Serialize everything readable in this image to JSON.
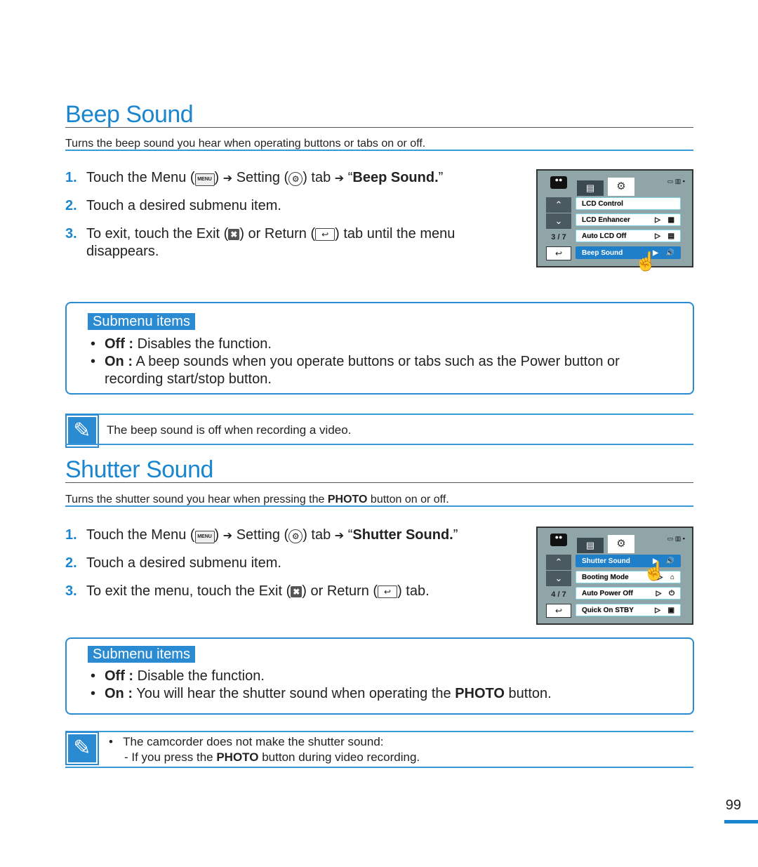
{
  "beep": {
    "title": "Beep Sound",
    "intro": "Turns the beep sound you hear when operating buttons or tabs on or off.",
    "steps": [
      {
        "num": "1.",
        "pre": "Touch the Menu (",
        "menu_icon": "MENU",
        "mid1": ") ",
        "arrow": "➔",
        "mid2": " Setting (",
        "gear_icon": "⚙",
        "mid3": ") tab ",
        "mid4": " “",
        "bold": "Beep Sound.",
        "post": "”"
      },
      {
        "num": "2.",
        "text": "Touch a desired submenu item."
      },
      {
        "num": "3.",
        "pre": "To exit, touch the Exit (",
        "exit_icon": "✖",
        "mid": ") or Return (",
        "return_icon": "↩",
        "post": ") tab until the menu",
        "line2": "disappears."
      }
    ],
    "submenu_label": "Submenu items",
    "submenu_items": [
      {
        "key": "Off :",
        "text": " Disables the function."
      },
      {
        "key": "On :",
        "text": " A beep sounds when you operate buttons or tabs such as the Power button or",
        "line2": "recording start/stop button."
      }
    ],
    "note": "The beep sound is off when recording a video.",
    "screen": {
      "page": "3 / 7",
      "items": [
        {
          "label": "LCD Control",
          "right": "",
          "selected": false
        },
        {
          "label": "LCD Enhancer",
          "right": "▷ ▦",
          "selected": false
        },
        {
          "label": "Auto LCD Off",
          "right": "▷ ▤",
          "selected": false
        },
        {
          "label": "Beep Sound",
          "right": "▶ 🔊",
          "selected": true
        }
      ]
    }
  },
  "shutter": {
    "title": "Shutter Sound",
    "intro_pre": "Turns the shutter sound you hear when pressing the ",
    "intro_bold": "PHOTO",
    "intro_post": " button on or off.",
    "steps": [
      {
        "num": "1.",
        "pre": "Touch the Menu (",
        "menu_icon": "MENU",
        "mid1": ") ",
        "arrow": "➔",
        "mid2": " Setting (",
        "gear_icon": "⚙",
        "mid3": ") tab ",
        "mid4": " “",
        "bold": "Shutter Sound.",
        "post": "”"
      },
      {
        "num": "2.",
        "text": "Touch a desired submenu item."
      },
      {
        "num": "3.",
        "pre": "To exit the menu, touch the Exit (",
        "exit_icon": "✖",
        "mid": ") or Return (",
        "return_icon": "↩",
        "post": ") tab."
      }
    ],
    "submenu_label": "Submenu items",
    "submenu_items": [
      {
        "key": "Off :",
        "text": " Disable the function."
      },
      {
        "key": "On :",
        "text_pre": " You will hear the shutter sound when operating the ",
        "bold": "PHOTO",
        "text_post": " button."
      }
    ],
    "note_line1": "The camcorder does not make the shutter sound:",
    "note_line2_pre": "-   If you press the ",
    "note_line2_bold": "PHOTO",
    "note_line2_post": " button during video recording.",
    "screen": {
      "page": "4 / 7",
      "items": [
        {
          "label": "Shutter Sound",
          "right": "▶ 🔊",
          "selected": true
        },
        {
          "label": "Booting Mode",
          "right": "▷ ⌂",
          "selected": false
        },
        {
          "label": "Auto Power Off",
          "right": "▷ ⏻",
          "selected": false
        },
        {
          "label": "Quick On STBY",
          "right": "▷ ▣",
          "selected": false
        }
      ]
    }
  },
  "screen_common": {
    "camera_icon": "●●",
    "menu_tab_icon": "▤",
    "settings_tab_icon": "⚙",
    "status": "▭ ▥ ▪",
    "up": "⌃",
    "down": "⌄",
    "return": "↩",
    "hand": "☝"
  },
  "page_number": "99",
  "note_icon": "✎",
  "colors": {
    "accent": "#1a86cf",
    "selected_item": "#1f7fc9",
    "screen_bg": "#8fa5a8"
  }
}
